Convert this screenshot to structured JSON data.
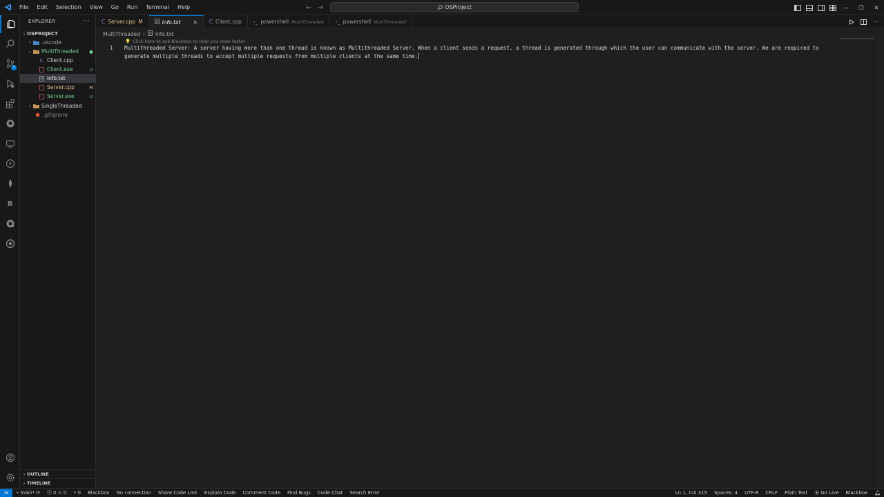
{
  "menu": [
    "File",
    "Edit",
    "Selection",
    "View",
    "Go",
    "Run",
    "Terminal",
    "Help"
  ],
  "command_center": {
    "label": "OSProject"
  },
  "sidebar": {
    "title": "EXPLORER",
    "root": "OSPROJECT",
    "items": [
      {
        "label": ".vscode",
        "badge": ""
      },
      {
        "label": "MultiThreaded",
        "badge": ""
      },
      {
        "label": "Client.cpp",
        "badge": ""
      },
      {
        "label": "Client.exe",
        "badge": "U"
      },
      {
        "label": "info.txt",
        "badge": ""
      },
      {
        "label": "Server.cpp",
        "badge": "M"
      },
      {
        "label": "Server.exe",
        "badge": "U"
      },
      {
        "label": "SingleThreaded",
        "badge": ""
      },
      {
        "label": ".gitignore",
        "badge": ""
      }
    ],
    "outline": "OUTLINE",
    "timeline": "TIMELINE"
  },
  "source_control_badge": "3",
  "tabs": [
    {
      "label": "Server.cpp",
      "badge": "M",
      "sub": ""
    },
    {
      "label": "info.txt",
      "badge": "",
      "sub": ""
    },
    {
      "label": "Client.cpp",
      "badge": "",
      "sub": ""
    },
    {
      "label": "powershell",
      "badge": "",
      "sub": "MultiThreaded"
    },
    {
      "label": "powershell",
      "badge": "",
      "sub": "MultiThreaded"
    }
  ],
  "breadcrumb": {
    "folder": "MultiThreaded",
    "file": "info.txt"
  },
  "editor": {
    "hint": "Click here to ask Blackbox to help you code faster",
    "line_number": "1",
    "text": "Multithreaded Server: A server having more than one thread is known as Multithreaded Server. When a client sends a request, a thread is generated through which the user can communicate with the server. We are required to generate multiple threads to accept multiple requests from multiple clients at the same time."
  },
  "statusbar": {
    "branch": "main*",
    "errors": "0",
    "warnings": "0",
    "ports": "0",
    "blackbox": "Blackbox",
    "connection": "No connection",
    "share": "Share Code Link",
    "explain": "Explain Code",
    "comment": "Comment Code",
    "bugs": "Find Bugs",
    "chat": "Code Chat",
    "search_error": "Search Error",
    "position": "Ln 1, Col 315",
    "spaces": "Spaces: 4",
    "encoding": "UTF-8",
    "eol": "CRLF",
    "language": "Plain Text",
    "golive": "Go Live",
    "blackbox_right": "Blackbox"
  },
  "colors": {
    "accent": "#0078d4",
    "git_untracked": "#73c991",
    "git_modified": "#e2c08d",
    "cpp_icon": "#a074c4"
  },
  "icons": [
    "explorer-icon",
    "search-icon",
    "source-control-icon",
    "run-debug-icon",
    "extensions-icon",
    "github-icon",
    "remote-explorer-icon",
    "lightning-icon",
    "leaf-icon",
    "blackbox-icon",
    "copilot-icon",
    "target-icon",
    "account-icon",
    "settings-gear-icon"
  ]
}
